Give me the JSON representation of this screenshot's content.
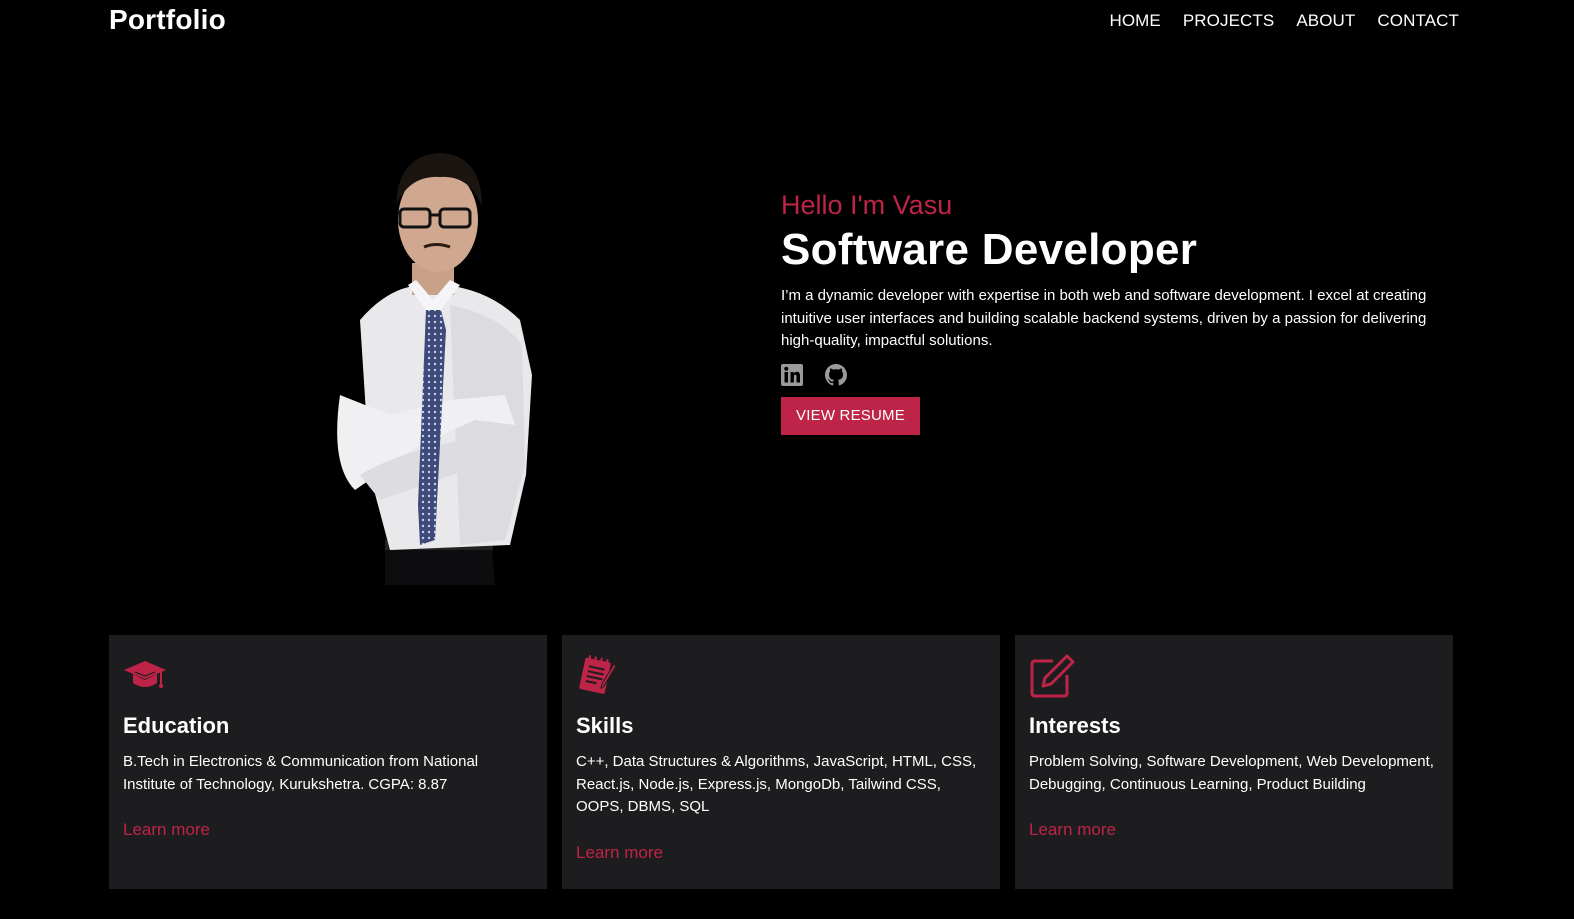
{
  "header": {
    "logo": "Portfolio",
    "nav": [
      "HOME",
      "PROJECTS",
      "ABOUT",
      "CONTACT"
    ]
  },
  "hero": {
    "greeting": "Hello I'm Vasu",
    "role": "Software Developer",
    "intro": "I’m a dynamic developer with expertise in both web and software development. I excel at creating intuitive user interfaces and building scalable backend systems, driven by a passion for delivering high-quality, impactful solutions.",
    "socials": [
      {
        "icon": "linkedin-icon"
      },
      {
        "icon": "github-icon"
      }
    ],
    "resume_button": "VIEW RESUME",
    "portrait_icon": "profile-photo"
  },
  "cards": [
    {
      "icon": "graduation-cap-icon",
      "title": "Education",
      "text": "B.Tech in Electronics & Communication from National Institute of Technology, Kurukshetra. CGPA: 8.87",
      "link": "Learn more"
    },
    {
      "icon": "notepad-pencil-icon",
      "title": "Skills",
      "text": "C++, Data Structures & Algorithms, JavaScript, HTML, CSS, React.js, Node.js, Express.js, MongoDb, Tailwind CSS, OOPS, DBMS, SQL",
      "link": "Learn more"
    },
    {
      "icon": "edit-icon",
      "title": "Interests",
      "text": "Problem Solving, Software Development, Web Development, Debugging, Continuous Learning, Product Building",
      "link": "Learn more"
    }
  ],
  "colors": {
    "background": "#000000",
    "accent": "#be2447",
    "card_background": "#1d1d1f",
    "text": "#ffffff",
    "icon_gray": "#9a9a9a"
  }
}
